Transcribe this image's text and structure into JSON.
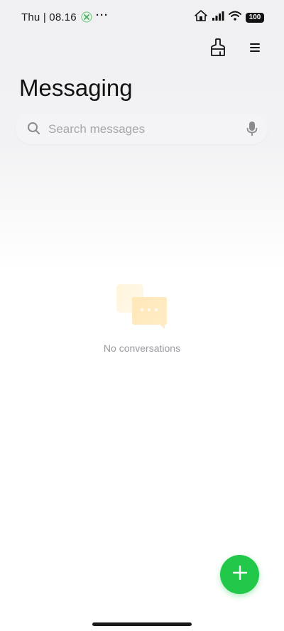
{
  "status_bar": {
    "time": "Thu | 08.16",
    "more": "···",
    "battery": "100",
    "icons": [
      "app-notification-icon",
      "house-alarm-icon",
      "signal-icon",
      "wifi-icon",
      "battery-icon"
    ]
  },
  "header": {
    "title": "Messaging",
    "actions": [
      "clean-brush-icon",
      "menu-icon"
    ]
  },
  "search": {
    "placeholder": "Search messages",
    "value": ""
  },
  "empty_state": {
    "text": "No conversations",
    "icon": "chat-bubbles-icon"
  },
  "fab": {
    "icon": "plus-icon",
    "color": "#22c84a"
  }
}
